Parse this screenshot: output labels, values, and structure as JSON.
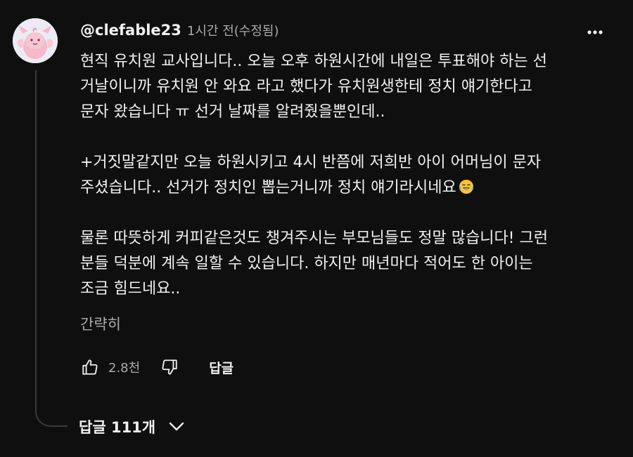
{
  "comment": {
    "author": "@clefable23",
    "timestamp": "1시간 전(수정됨)",
    "paragraphs": [
      [
        "현직 유치원 교사입니다.. 오늘 오후 하원시간에 내일은 투표해야 하는 선",
        "거날이니까 유치원 안 와요 라고 했다가 유치원생한테 정치 얘기한다고",
        "문자 왔습니다 ㅠ 선거 날짜를 알려줬을뿐인데.."
      ],
      [
        "+거짓말같지만 오늘 하원시키고 4시 반쯤에 저희반 아이 어머님이 문자",
        "주셨습니다.. 선거가 정치인 뽑는거니까 정치 얘기라시네요"
      ],
      [
        "물론 따뜻하게 커피같은것도 챙겨주시는 부모님들도 정말 많습니다! 그런",
        "분들 덕분에 계속 일할 수 있습니다. 하지만 매년마다 적어도 한 아이는",
        "조금 힘드네요.."
      ]
    ],
    "collapse_label": "간략히",
    "like_count": "2.8천",
    "reply_label": "답글",
    "replies_label": "답글 111개"
  },
  "icons": {
    "more": "more-vert-icon",
    "like": "thumb-up-icon",
    "dislike": "thumb-down-icon",
    "expand": "chevron-down-icon",
    "emoji": "tears-of-joy-emoji"
  },
  "colors": {
    "background": "#0f0f0f",
    "text_primary": "#f1f1f1",
    "text_secondary": "#aaaaaa",
    "thread_line": "#3a3a3a"
  }
}
